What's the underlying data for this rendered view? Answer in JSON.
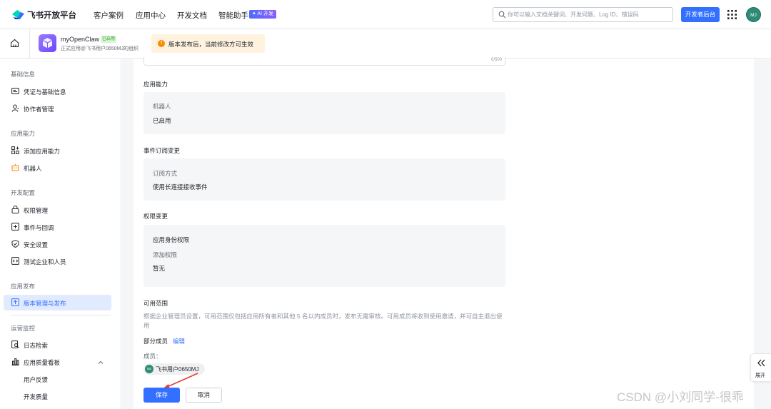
{
  "topbar": {
    "logo_text": "飞书开放平台",
    "nav": [
      "客户案例",
      "应用中心",
      "开发文档",
      "智能助手"
    ],
    "ai_badge": "✦ AI 开发",
    "search_placeholder": "你可以输入文档关键词、开发问题、Log ID、错误码",
    "dev_console_label": "开发者后台",
    "avatar_initials": "MJ"
  },
  "app": {
    "name": "myOpenClaw",
    "status": "已启用",
    "org": "正式应用@飞书用户0650MJ的组织"
  },
  "notice": {
    "icon": "!",
    "text": "版本发布后，当前修改方可生效"
  },
  "sidebar": {
    "groups": {
      "basic": "基础信息",
      "capability": "应用能力",
      "config": "开发配置",
      "release": "应用发布",
      "monitor": "运营监控"
    },
    "items": {
      "credentials": "凭证与基础信息",
      "collaborators": "协作者管理",
      "add_capability": "添加应用能力",
      "bot": "机器人",
      "permissions": "权限管理",
      "events": "事件与回调",
      "security": "安全设置",
      "test_enterprise": "测试企业和人员",
      "version_release": "版本管理与发布",
      "log_search": "日志检索",
      "quality_dashboard": "应用质量看板",
      "user_feedback": "用户反馈",
      "dev_quality": "开发质量"
    }
  },
  "main": {
    "top_box_count": "0/500",
    "capability_section": {
      "title": "应用能力",
      "label": "机器人",
      "value": "已启用"
    },
    "event_section": {
      "title": "事件订阅变更",
      "label": "订阅方式",
      "value": "使用长连接接收事件"
    },
    "permission_section": {
      "title": "权限变更",
      "identity_label": "应用身份权限",
      "added_label": "添加权限",
      "added_value": "暂无"
    },
    "scope_section": {
      "title": "可用范围",
      "description": "根据企业管理员设置，可用范围仅包括应用所有者和其他 5 名以内成员时，发布无需审核。可用成员将收到使用邀请，并可自主退出使用",
      "scope_value": "部分成员",
      "edit_label": "编辑",
      "members_label": "成员：",
      "member_initials": "MJ",
      "member_name": "飞书用户0650MJ"
    },
    "save_label": "保存",
    "cancel_label": "取消"
  },
  "expand_tab": {
    "label": "展开"
  },
  "watermark": "CSDN @小刘同学-很乖",
  "colors": {
    "primary": "#3370ff",
    "warning": "#ff8800",
    "success": "#2ea121",
    "annotation_red": "#e53935"
  }
}
